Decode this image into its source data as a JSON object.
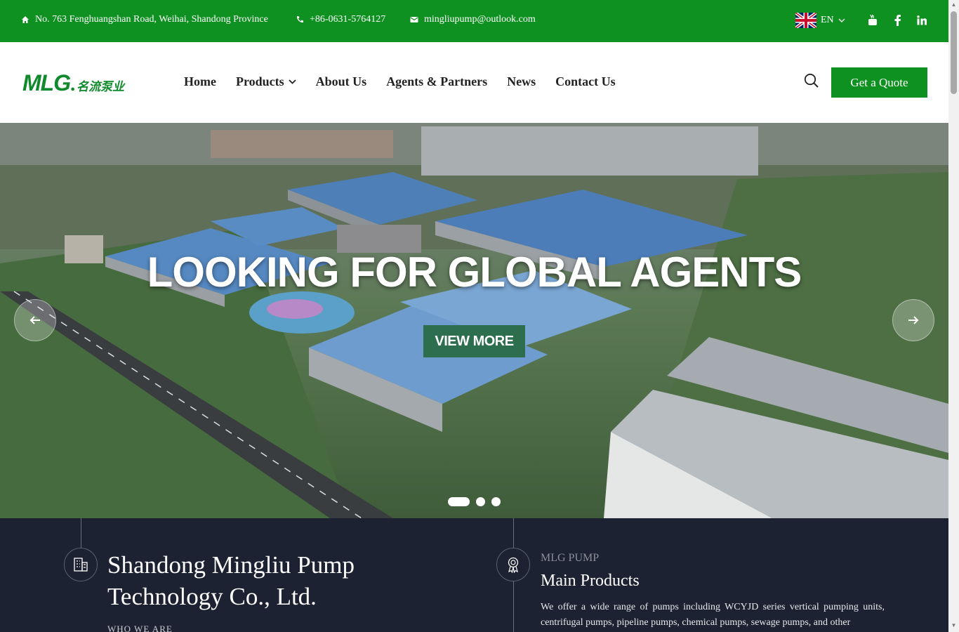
{
  "topbar": {
    "address": "No. 763 Fenghuangshan Road, Weihai, Shandong Province",
    "phone": "+86-0631-5764127",
    "email": "mingliupump@outlook.com",
    "language": "EN"
  },
  "header": {
    "logo_text": "MLG",
    "logo_cn": "名流泵业",
    "nav": [
      {
        "label": "Home"
      },
      {
        "label": "Products"
      },
      {
        "label": "About Us"
      },
      {
        "label": "Agents & Partners"
      },
      {
        "label": "News"
      },
      {
        "label": "Contact Us"
      }
    ],
    "quote_label": "Get a Quote"
  },
  "hero": {
    "title": "LOOKING FOR GLOBAL AGENTS",
    "button_label": "VIEW MORE",
    "slides": 3,
    "active_slide": 1
  },
  "intro": {
    "company_line1": "Shandong Mingliu Pump",
    "company_line2": "Technology Co., Ltd.",
    "who_label": "WHO WE ARE",
    "eyebrow": "MLG PUMP",
    "heading": "Main Products",
    "description": "We offer a wide range of pumps including WCYJD series vertical pumping units, centrifugal pumps, pipeline pumps, chemical pumps, sewage pumps, and other"
  },
  "colors": {
    "brand_green": "#0f9121",
    "dark_bg": "#1c2231",
    "hero_button": "#2d6e4e"
  },
  "icons": {
    "address": "home-icon",
    "phone": "phone-icon",
    "email": "mail-icon",
    "flag": "uk-flag-icon",
    "social": [
      "youtube-icon",
      "facebook-icon",
      "linkedin-icon"
    ],
    "search": "search-icon",
    "company": "building-icon",
    "products": "award-icon"
  }
}
